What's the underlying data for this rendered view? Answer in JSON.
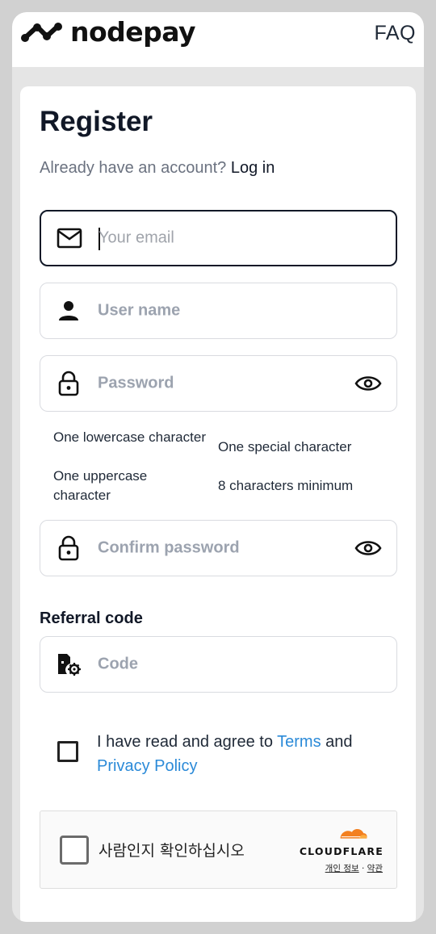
{
  "header": {
    "brand": "nodepay",
    "faq_label": "FAQ",
    "logo_icon": "nodepay-logo-icon"
  },
  "register": {
    "title": "Register",
    "subtitle_text": "Already have an account? ",
    "login_link": "Log in"
  },
  "fields": {
    "email": {
      "placeholder": "Your email",
      "icon": "mail-icon"
    },
    "username": {
      "placeholder": "User name",
      "icon": "user-icon"
    },
    "password": {
      "placeholder": "Password",
      "icon": "lock-icon",
      "toggle_icon": "eye-icon"
    },
    "confirm_password": {
      "placeholder": "Confirm password",
      "icon": "lock-icon",
      "toggle_icon": "eye-icon"
    },
    "referral": {
      "label": "Referral code",
      "placeholder": "Code",
      "icon": "referral-code-icon"
    }
  },
  "password_rules": {
    "lowercase": "One lowercase character",
    "special": "One special character",
    "uppercase": "One uppercase character",
    "minimum": "8 characters minimum"
  },
  "agreement": {
    "prefix": "I have read and agree to ",
    "terms": "Terms",
    "middle": " and",
    "privacy": "Privacy Policy"
  },
  "captcha": {
    "label": "사람인지 확인하십시오",
    "brand": "CLOUDFLARE",
    "privacy_link": "개인 정보",
    "separator": "·",
    "terms_link": "약관"
  },
  "colors": {
    "link": "#2b8ad8",
    "cloudflare_orange": "#f38020",
    "text_primary": "#111827",
    "placeholder": "#9ca3af"
  }
}
